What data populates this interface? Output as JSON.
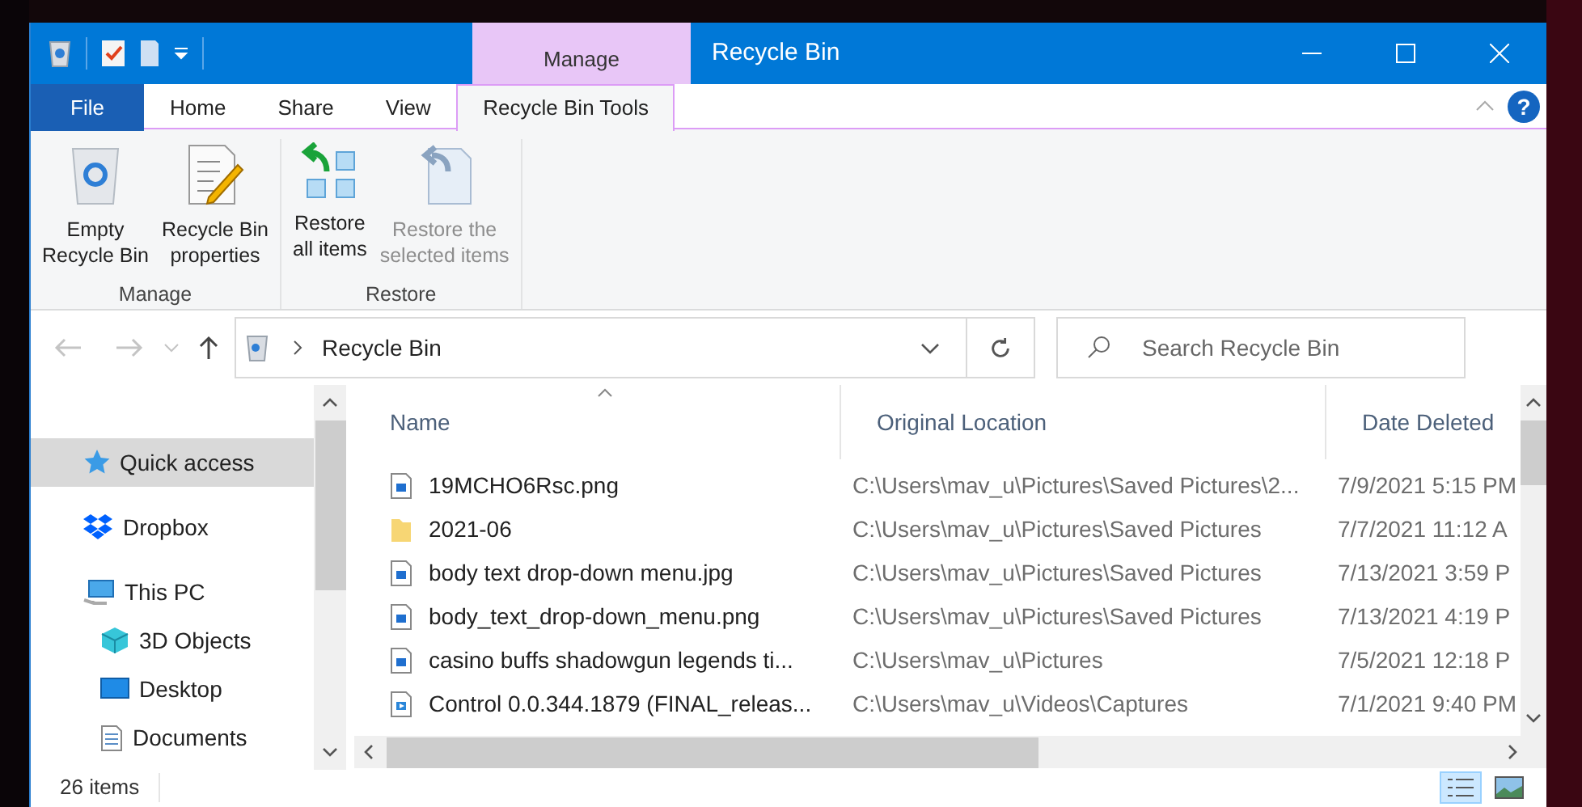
{
  "window": {
    "title": "Recycle Bin",
    "context_group": "Manage",
    "help_glyph": "?"
  },
  "ribbon_tabs": [
    {
      "label": "File",
      "kind": "file",
      "selected": false
    },
    {
      "label": "Home",
      "kind": "tab",
      "selected": false
    },
    {
      "label": "Share",
      "kind": "tab",
      "selected": false
    },
    {
      "label": "View",
      "kind": "tab",
      "selected": false
    },
    {
      "label": "Recycle Bin Tools",
      "kind": "context",
      "selected": true
    }
  ],
  "ribbon_groups": [
    {
      "label": "Manage",
      "commands": [
        {
          "lines": [
            "Empty",
            "Recycle Bin"
          ],
          "kind": "empty_bin",
          "disabled": false
        },
        {
          "lines": [
            "Recycle Bin",
            "properties"
          ],
          "kind": "properties",
          "disabled": false
        }
      ]
    },
    {
      "label": "Restore",
      "commands": [
        {
          "lines": [
            "Restore",
            "all items"
          ],
          "kind": "restore_all",
          "disabled": false
        },
        {
          "lines": [
            "Restore the",
            "selected items"
          ],
          "kind": "restore_selected",
          "disabled": true
        }
      ]
    }
  ],
  "address": {
    "location": "Recycle Bin"
  },
  "search": {
    "placeholder": "Search Recycle Bin"
  },
  "navigation": [
    {
      "label": "Quick access",
      "kind": "star",
      "selected": true
    },
    {
      "label": "Dropbox",
      "kind": "dropbox",
      "selected": false
    },
    {
      "label": "This PC",
      "kind": "pc",
      "selected": false,
      "children": [
        {
          "label": "3D Objects",
          "kind": "cube",
          "selected": false
        },
        {
          "label": "Desktop",
          "kind": "desktop",
          "selected": false
        },
        {
          "label": "Documents",
          "kind": "documents",
          "selected": false
        }
      ]
    }
  ],
  "columns": [
    {
      "label": "Name",
      "sorted": true
    },
    {
      "label": "Original Location",
      "sorted": false
    },
    {
      "label": "Date Deleted",
      "sorted": false
    }
  ],
  "rows": [
    {
      "name": "19MCHO6Rsc.png",
      "kind": "image",
      "location": "C:\\Users\\mav_u\\Pictures\\Saved Pictures\\2...",
      "date": "7/9/2021 5:15 PM"
    },
    {
      "name": "2021-06",
      "kind": "folder",
      "location": "C:\\Users\\mav_u\\Pictures\\Saved Pictures",
      "date": "7/7/2021 11:12 A"
    },
    {
      "name": "body text drop-down menu.jpg",
      "kind": "image",
      "location": "C:\\Users\\mav_u\\Pictures\\Saved Pictures",
      "date": "7/13/2021 3:59 P"
    },
    {
      "name": "body_text_drop-down_menu.png",
      "kind": "image",
      "location": "C:\\Users\\mav_u\\Pictures\\Saved Pictures",
      "date": "7/13/2021 4:19 P"
    },
    {
      "name": "casino buffs shadowgun legends ti...",
      "kind": "image",
      "location": "C:\\Users\\mav_u\\Pictures",
      "date": "7/5/2021 12:18 P"
    },
    {
      "name": "Control 0.0.344.1879 (FINAL_releas...",
      "kind": "video",
      "location": "C:\\Users\\mav_u\\Videos\\Captures",
      "date": "7/1/2021 9:40 PM"
    }
  ],
  "status_bar": {
    "item_count": "26 items"
  },
  "view_buttons": [
    {
      "kind": "details",
      "selected": true
    },
    {
      "kind": "large_icons",
      "selected": false
    }
  ]
}
